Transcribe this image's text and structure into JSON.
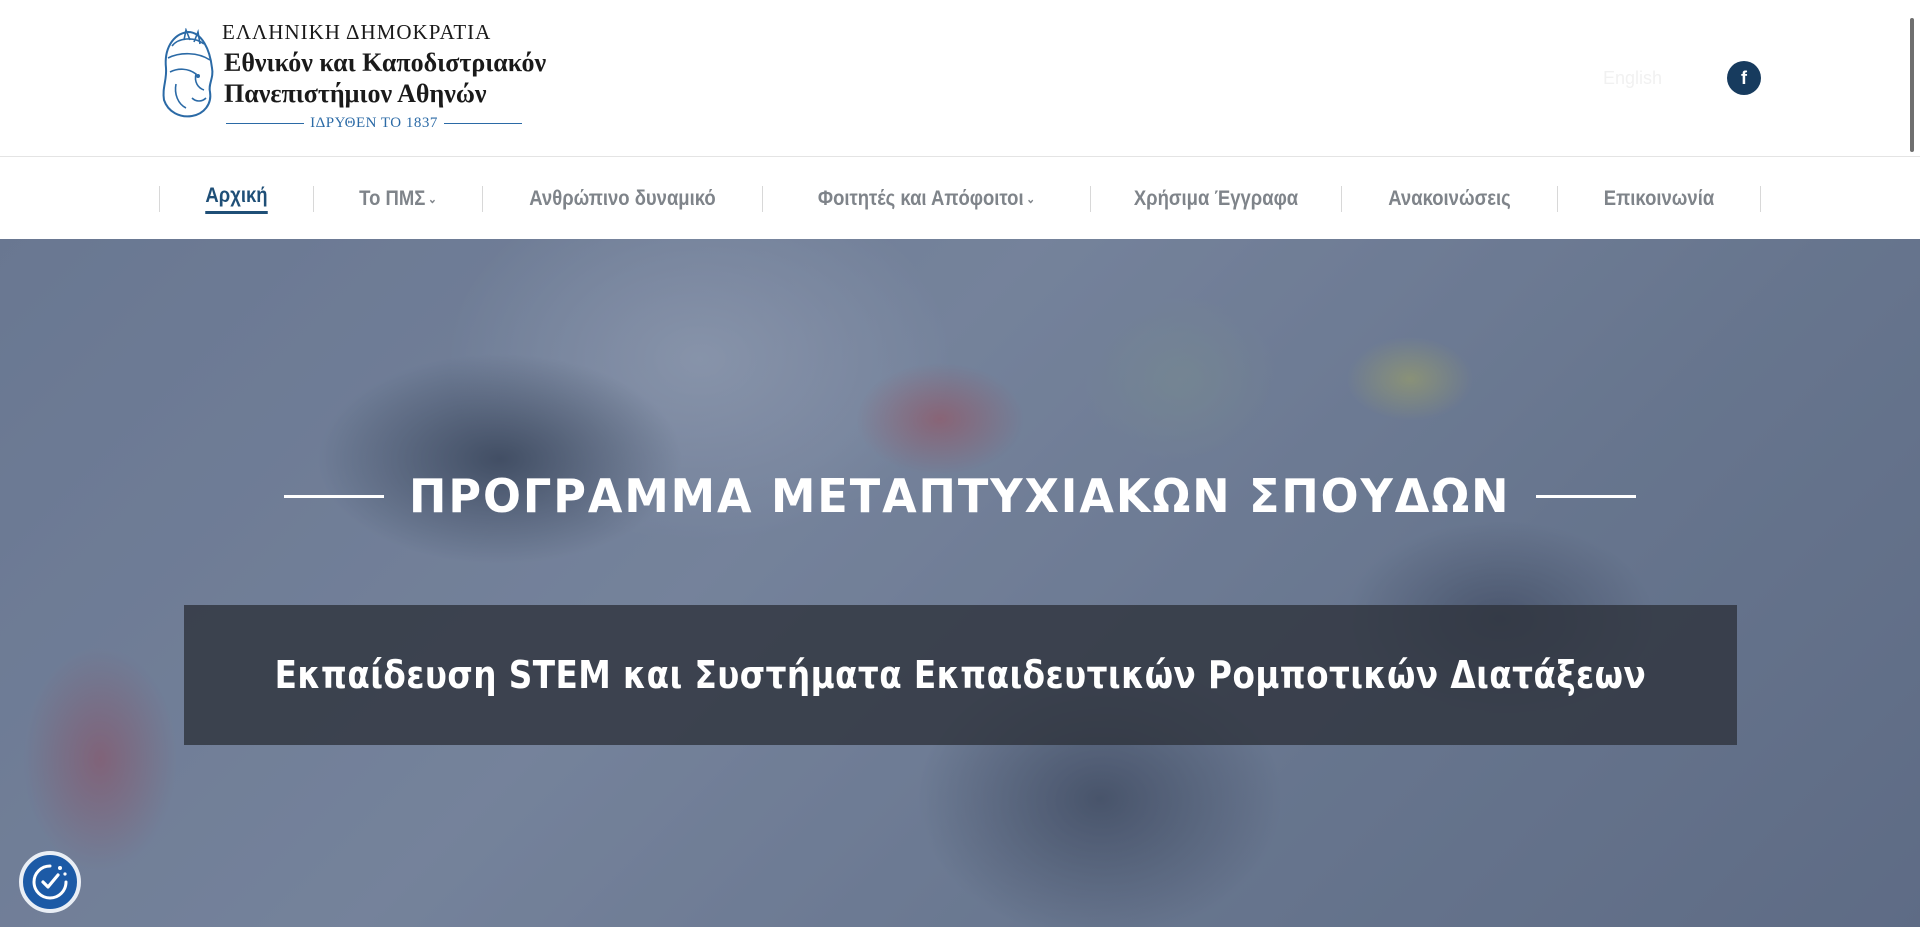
{
  "header": {
    "logo": {
      "line1": "ΕΛΛΗΝΙΚΗ ΔΗΜΟΚΡΑΤΙΑ",
      "line2": "Εθνικόν και Καποδιστριακόν",
      "line3": "Πανεπιστήμιον Αθηνών",
      "founded": "ΙΔΡΥΘΕΝ ΤΟ 1837",
      "emblem_icon": "athena-head-icon"
    },
    "language_link": "English",
    "social": {
      "facebook_label": "f",
      "icon": "facebook-icon",
      "color": "#173b5e"
    }
  },
  "nav": {
    "items": [
      {
        "label": "Αρχική",
        "active": true,
        "dropdown": false
      },
      {
        "label": "Το ΠΜΣ",
        "active": false,
        "dropdown": true
      },
      {
        "label": "Ανθρώπινο δυναμικό",
        "active": false,
        "dropdown": false
      },
      {
        "label": "Φοιτητές και Απόφοιτοι",
        "active": false,
        "dropdown": true
      },
      {
        "label": "Χρήσιμα Έγγραφα",
        "active": false,
        "dropdown": false
      },
      {
        "label": "Ανακοινώσεις",
        "active": false,
        "dropdown": false
      },
      {
        "label": "Επικοινωνία",
        "active": false,
        "dropdown": false
      }
    ],
    "active_color": "#1f4f77",
    "inactive_color": "#7f848a",
    "dropdown_icon": "chevron-down-icon"
  },
  "hero": {
    "title": "ΠΡΟΓΡΑΜΜΑ ΜΕΤΑΠΤΥΧΙΑΚΩΝ ΣΠΟΥΔΩΝ",
    "subtitle": "Εκπαίδευση STEM και Συστήματα Εκπαιδευτικών Ρομποτικών Διατάξεων"
  },
  "accessibility": {
    "icon": "accessibility-icon",
    "color": "#1c5aa6"
  }
}
